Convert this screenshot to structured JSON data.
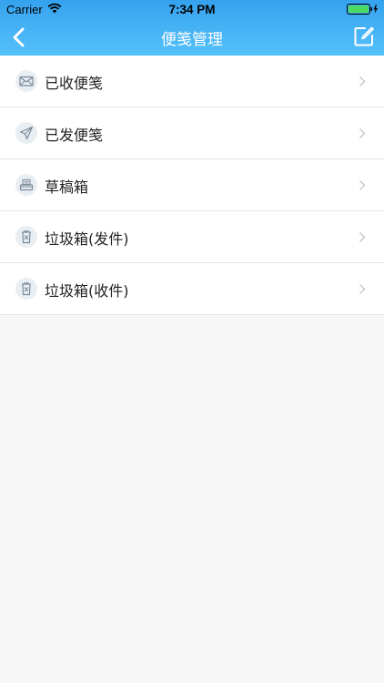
{
  "status_bar": {
    "carrier": "Carrier",
    "time": "7:34 PM",
    "battery_level": 1.0
  },
  "nav": {
    "title": "便笺管理",
    "back_icon": "chevron-left-icon",
    "compose_icon": "compose-icon",
    "accent_top": "#35a2ee",
    "accent_bottom": "#55c1fb"
  },
  "menu": {
    "items": [
      {
        "label": "已收便笺",
        "icon": "envelope-icon"
      },
      {
        "label": "已发便笺",
        "icon": "paper-plane-icon"
      },
      {
        "label": "草稿箱",
        "icon": "draft-tray-icon"
      },
      {
        "label": "垃圾箱(发件)",
        "icon": "trash-icon"
      },
      {
        "label": "垃圾箱(收件)",
        "icon": "trash-icon"
      }
    ]
  }
}
